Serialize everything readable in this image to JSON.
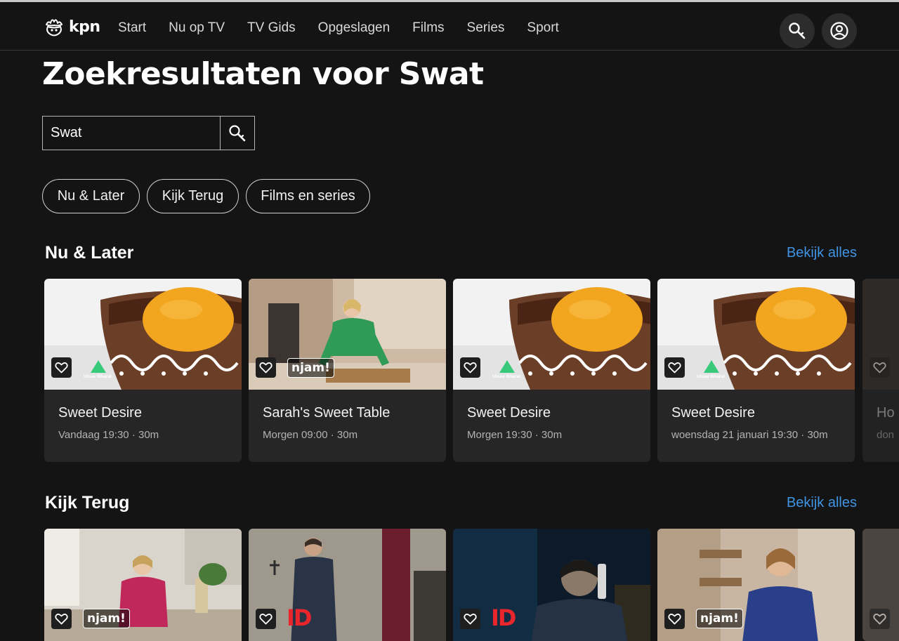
{
  "header": {
    "logo_text": "kpn",
    "nav": [
      "Start",
      "Nu op TV",
      "TV Gids",
      "Opgeslagen",
      "Films",
      "Series",
      "Sport"
    ]
  },
  "page_title": "Zoekresultaten voor Swat",
  "search": {
    "value": "Swat"
  },
  "filters": [
    "Nu & Later",
    "Kijk Terug",
    "Films en series"
  ],
  "sections": {
    "nu_later": {
      "title": "Nu & Later",
      "see_all": "Bekijk alles",
      "cards": [
        {
          "title": "Sweet Desire",
          "meta": "Vandaag 19:30 · 30m",
          "channel": "Utsav Bharat"
        },
        {
          "title": "Sarah's Sweet Table",
          "meta": "Morgen 09:00 · 30m",
          "channel": "njam!"
        },
        {
          "title": "Sweet Desire",
          "meta": "Morgen 19:30 · 30m",
          "channel": "Utsav Bharat"
        },
        {
          "title": "Sweet Desire",
          "meta": "woensdag 21 januari 19:30 · 30m",
          "channel": "Utsav Bharat"
        },
        {
          "title": "Ho",
          "meta": "don"
        }
      ]
    },
    "kijk_terug": {
      "title": "Kijk Terug",
      "see_all": "Bekijk alles",
      "cards": [
        {
          "channel": "njam!"
        },
        {
          "channel": "ID"
        },
        {
          "channel": "ID"
        },
        {
          "channel": "njam!"
        }
      ]
    }
  },
  "colors": {
    "background": "#141414",
    "card": "#262626",
    "link": "#3f94e3",
    "id_red": "#e8262c",
    "utsav_green": "#39c97a"
  },
  "icons": [
    "kpn-crown-icon",
    "search-icon",
    "account-icon",
    "heart-icon"
  ]
}
